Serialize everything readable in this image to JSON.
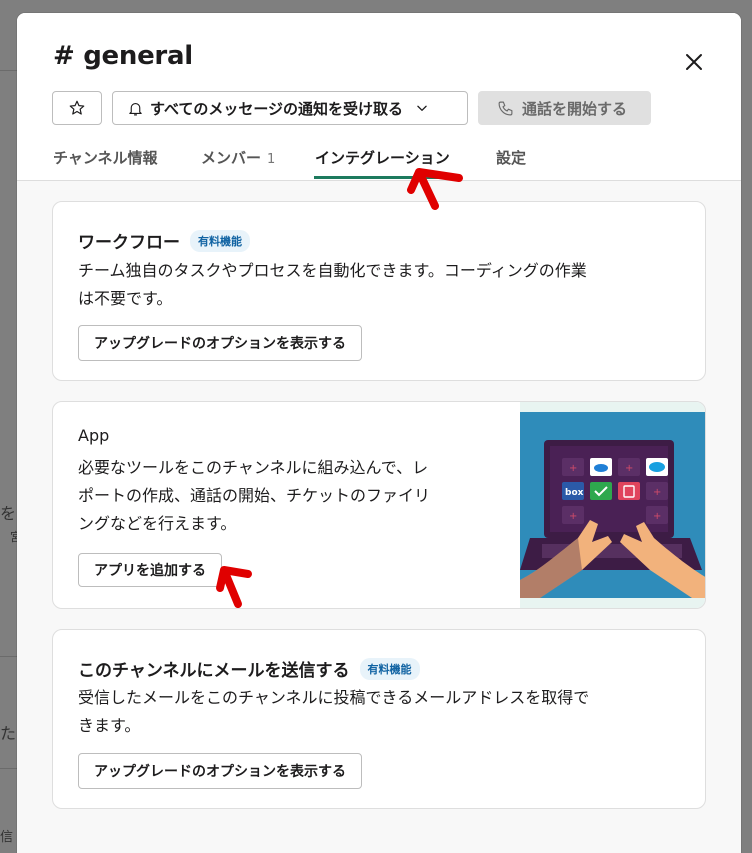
{
  "background": {
    "fragment_left": "を",
    "fragment_left_small": "宮",
    "fragment_bottom": "た",
    "fragment_bottom2": "信"
  },
  "modal": {
    "title": "# general",
    "buttons": {
      "star_icon": "star-icon",
      "notify_label": "すべてのメッセージの通知を受け取る",
      "call_label": "通話を開始する"
    },
    "tabs": [
      {
        "label": "チャンネル情報"
      },
      {
        "label": "メンバー",
        "count": "1"
      },
      {
        "label": "インテグレーション",
        "active": true
      },
      {
        "label": "設定"
      }
    ]
  },
  "cards": {
    "workflow": {
      "title": "ワークフロー",
      "badge": "有料機能",
      "desc_line1": "チーム独自のタスクやプロセスを自動化できます。コーディングの作業",
      "desc_line2": "は不要です。",
      "button": "アップグレードのオプションを表示する"
    },
    "app": {
      "title": "App",
      "desc_line1": "必要なツールをこのチャンネルに組み込んで、レ",
      "desc_line2": "ポートの作成、通話の開始、チケットのファイリ",
      "desc_line3": "ングなどを行えます。",
      "button": "アプリを追加する",
      "illustration_box_label": "box"
    },
    "email": {
      "title": "このチャンネルにメールを送信する",
      "badge": "有料機能",
      "desc_line1": "受信したメールをこのチャンネルに投稿できるメールアドレスを取得で",
      "desc_line2": "きます。",
      "button": "アップグレードのオプションを表示する"
    }
  },
  "colors": {
    "tab_underline": "#1d7a5e",
    "badge_text": "#1264a3",
    "badge_bg": "#e8f3fa",
    "annotation_red": "#e00000",
    "illustration_bg": "#2f8cba"
  }
}
